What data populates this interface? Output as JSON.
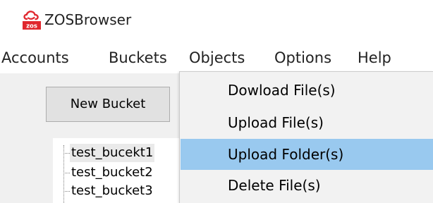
{
  "window": {
    "title": "ZOSBrowser",
    "logo_text": "zos",
    "logo_icon": "cloud-logo-icon",
    "brand_color": "#e0282e"
  },
  "menubar": {
    "items": [
      {
        "label": "Accounts"
      },
      {
        "label": "Buckets"
      },
      {
        "label": "Objects"
      },
      {
        "label": "Options"
      },
      {
        "label": "Help"
      }
    ],
    "open_menu": "Objects"
  },
  "sidebar": {
    "new_bucket_label": "New Bucket",
    "buckets": [
      {
        "label": "test_bucekt1",
        "selected": true
      },
      {
        "label": "test_bucket2",
        "selected": false
      },
      {
        "label": "test_bucket3",
        "selected": false
      }
    ]
  },
  "objects_menu": {
    "items": [
      {
        "label": "Dowload File(s)",
        "highlighted": false
      },
      {
        "label": "Upload File(s)",
        "highlighted": false
      },
      {
        "label": "Upload Folder(s)",
        "highlighted": true
      },
      {
        "label": "Delete File(s)",
        "highlighted": false
      }
    ],
    "highlight_color": "#99c9ef"
  }
}
